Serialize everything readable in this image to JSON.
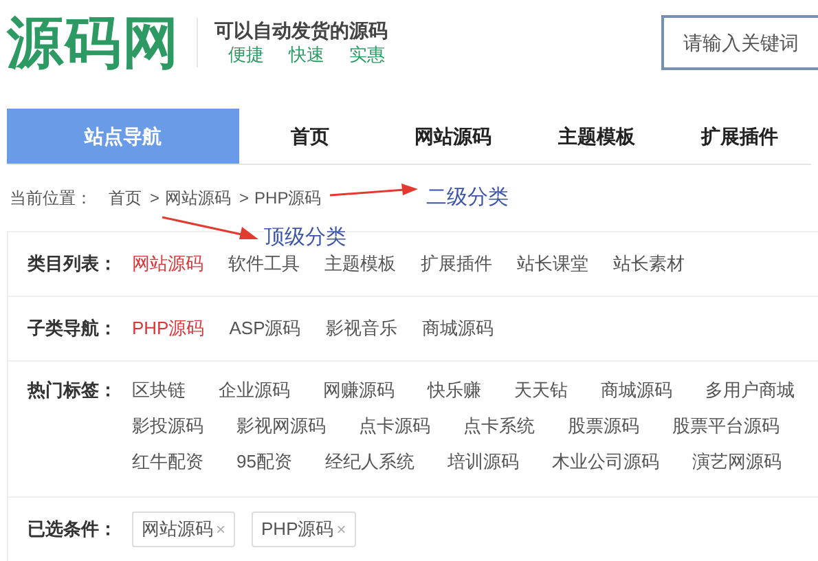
{
  "header": {
    "logo": "源码网",
    "slogan": "可以自动发货的源码",
    "features": [
      "便捷",
      "快速",
      "实惠"
    ],
    "search": {
      "placeholder": "请输入关键词"
    }
  },
  "nav": [
    {
      "label": "站点导航",
      "selected": true
    },
    {
      "label": "首页",
      "selected": false
    },
    {
      "label": "网站源码",
      "selected": false
    },
    {
      "label": "主题模板",
      "selected": false
    },
    {
      "label": "扩展插件",
      "selected": false
    }
  ],
  "breadcrumb": {
    "label": "当前位置：",
    "items": [
      "首页",
      "网站源码",
      "PHP源码"
    ],
    "separator": ">"
  },
  "annotations": [
    {
      "text": "二级分类"
    },
    {
      "text": "顶级分类"
    }
  ],
  "filters": [
    {
      "label": "类目列表：",
      "items": [
        {
          "text": "网站源码",
          "selected": true
        },
        {
          "text": "软件工具",
          "selected": false
        },
        {
          "text": "主题模板",
          "selected": false
        },
        {
          "text": "扩展插件",
          "selected": false
        },
        {
          "text": "站长课堂",
          "selected": false
        },
        {
          "text": "站长素材",
          "selected": false
        }
      ]
    },
    {
      "label": "子类导航：",
      "items": [
        {
          "text": "PHP源码",
          "selected": true
        },
        {
          "text": "ASP源码",
          "selected": false
        },
        {
          "text": "影视音乐",
          "selected": false
        },
        {
          "text": "商城源码",
          "selected": false
        }
      ]
    }
  ],
  "hot_tags": {
    "label": "热门标签：",
    "tags": [
      "区块链",
      "企业源码",
      "网赚源码",
      "快乐赚",
      "天天钻",
      "商城源码",
      "多用户商城",
      "影投源码",
      "影视网源码",
      "点卡源码",
      "点卡系统",
      "股票源码",
      "股票平台源码",
      "红牛配资",
      "95配资",
      "经纪人系统",
      "培训源码",
      "木业公司源码",
      "演艺网源码"
    ]
  },
  "selected_conditions": {
    "label": "已选条件：",
    "chips": [
      {
        "text": "网站源码",
        "remove": "×"
      },
      {
        "text": "PHP源码",
        "remove": "×"
      }
    ]
  }
}
